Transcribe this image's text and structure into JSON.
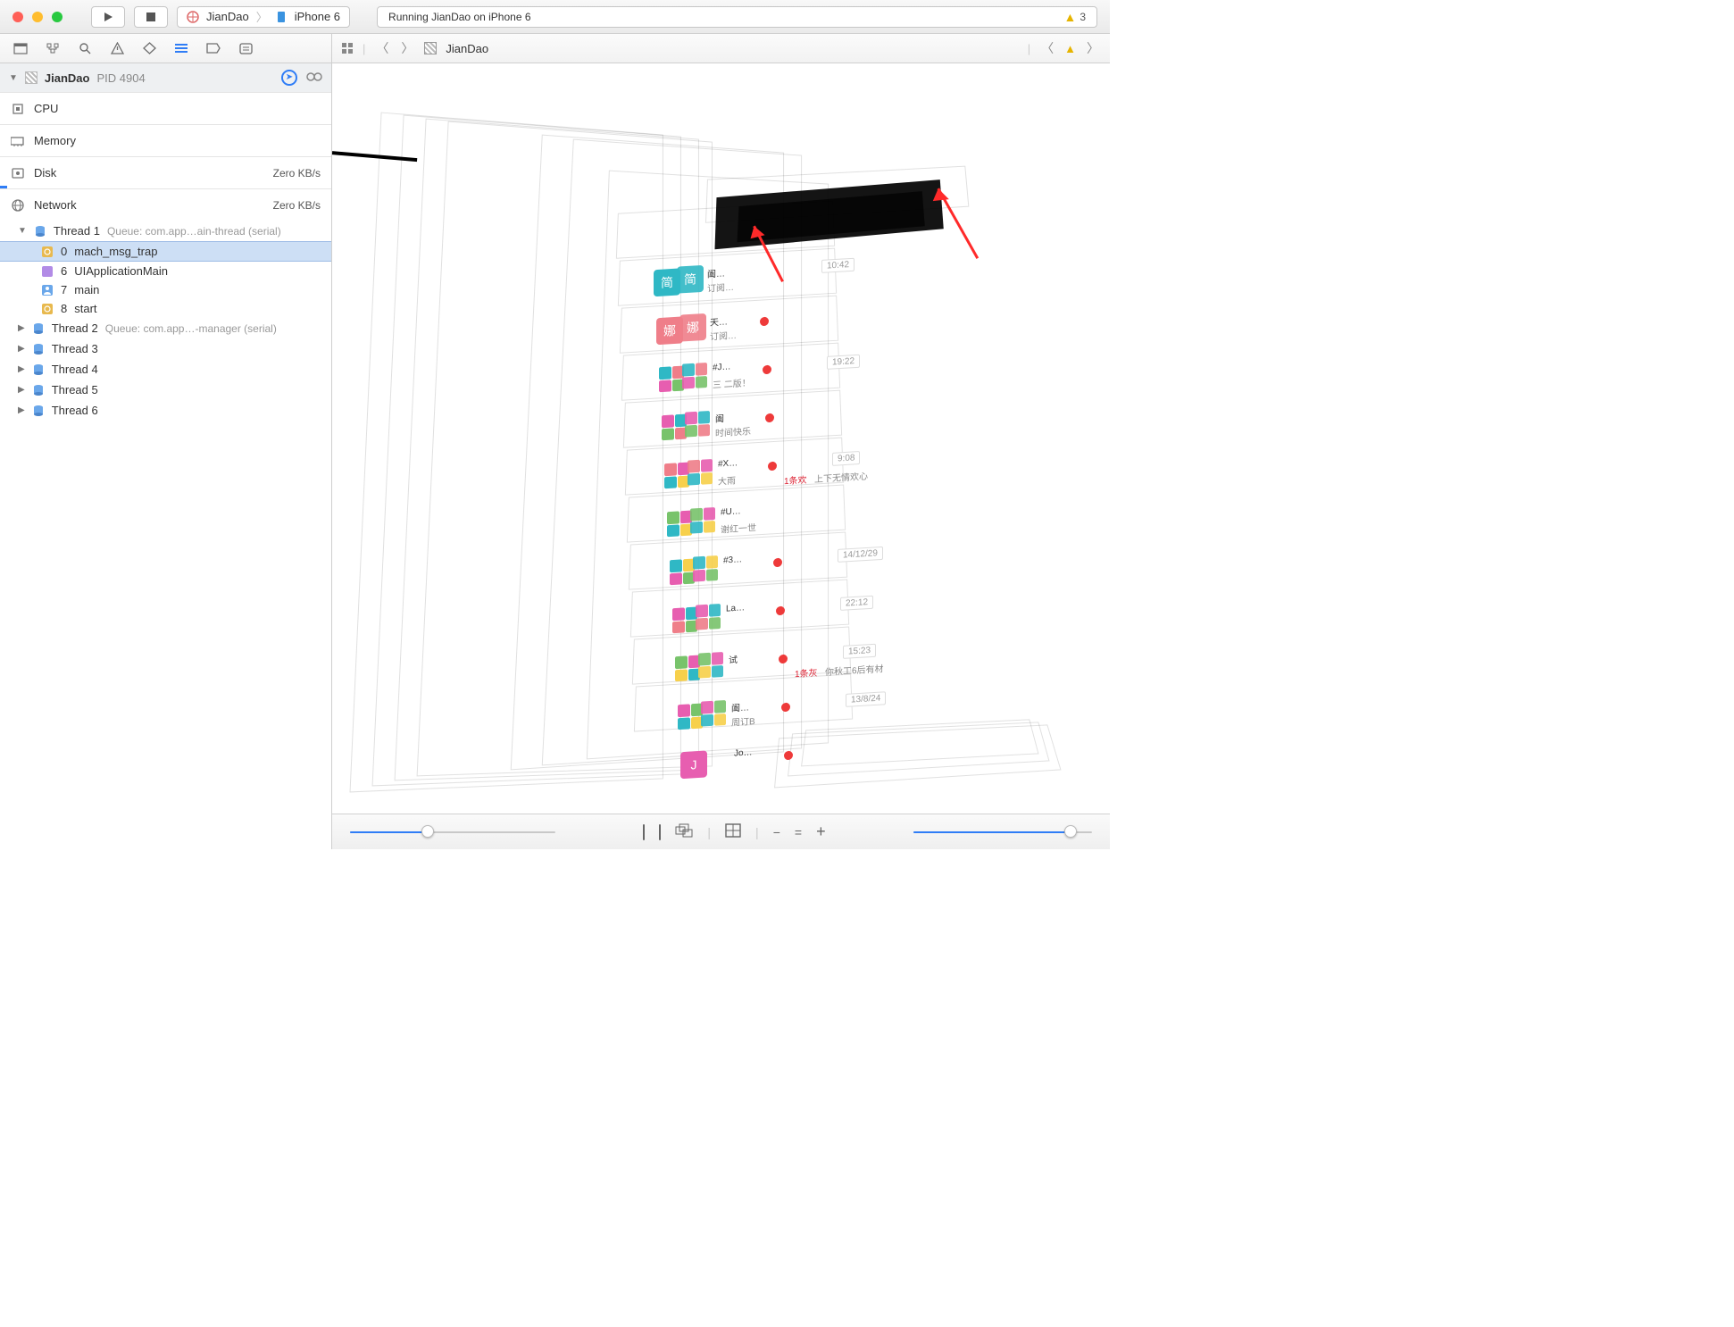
{
  "titlebar": {
    "crumb_app": "JianDao",
    "crumb_target": "iPhone 6",
    "status_text": "Running JianDao on iPhone 6",
    "warning_count": "3"
  },
  "jumpbar": {
    "project": "JianDao"
  },
  "process": {
    "name": "JianDao",
    "pid_label": "PID 4904"
  },
  "metrics": {
    "cpu": {
      "label": "CPU"
    },
    "memory": {
      "label": "Memory"
    },
    "disk": {
      "label": "Disk",
      "value": "Zero KB/s"
    },
    "network": {
      "label": "Network",
      "value": "Zero KB/s"
    }
  },
  "threads": [
    {
      "title": "Thread 1",
      "queue": "Queue: com.app…ain-thread (serial)",
      "expanded": true
    },
    {
      "title": "Thread 2",
      "queue": "Queue: com.app…-manager (serial)",
      "expanded": false
    },
    {
      "title": "Thread 3",
      "queue": "",
      "expanded": false
    },
    {
      "title": "Thread 4",
      "queue": "",
      "expanded": false
    },
    {
      "title": "Thread 5",
      "queue": "",
      "expanded": false
    },
    {
      "title": "Thread 6",
      "queue": "",
      "expanded": false
    }
  ],
  "frames": [
    {
      "idx": "0",
      "name": "mach_msg_trap",
      "selected": true,
      "icon": "gear"
    },
    {
      "idx": "6",
      "name": "UIApplicationMain",
      "selected": false,
      "icon": "app"
    },
    {
      "idx": "7",
      "name": "main",
      "selected": false,
      "icon": "user"
    },
    {
      "idx": "8",
      "name": "start",
      "selected": false,
      "icon": "gear"
    }
  ],
  "cells": [
    {
      "avatar": "简",
      "avatar2": "简",
      "av_class": "teal",
      "title": "阖…",
      "sub": "订阅…",
      "dot": false,
      "ts": "10:42"
    },
    {
      "avatar": "娜",
      "avatar2": "娜",
      "av_class": "pink",
      "title": "天…",
      "sub": "订阅…",
      "dot": true,
      "ts": ""
    },
    {
      "quad": [
        "#2fb8c5",
        "#ef7e89",
        "#e75eb0",
        "#78c36b"
      ],
      "title": "#J…",
      "sub": "三 二版！",
      "dot": true,
      "ts": "19:22"
    },
    {
      "quad": [
        "#e75eb0",
        "#2fb8c5",
        "#78c36b",
        "#ef7e89"
      ],
      "title": "阖",
      "sub": "时间快乐",
      "dot": true,
      "ts": ""
    },
    {
      "quad": [
        "#ef7e89",
        "#e75eb0",
        "#2fb8c5",
        "#f7d04b"
      ],
      "title": "#X…",
      "sub": "大雨",
      "dot": true,
      "ts": "9:08",
      "note": "上下无情欢心",
      "pinsub": "1条欢"
    },
    {
      "quad": [
        "#78c36b",
        "#e75eb0",
        "#2fb8c5",
        "#f7d04b"
      ],
      "title": "#U…",
      "sub": "谢红一世",
      "dot": false,
      "ts": ""
    },
    {
      "quad": [
        "#2fb8c5",
        "#f7d04b",
        "#e75eb0",
        "#78c36b"
      ],
      "title": "#3…",
      "sub": "",
      "dot": true,
      "ts": "14/12/29"
    },
    {
      "quad": [
        "#e75eb0",
        "#2fb8c5",
        "#ef7e89",
        "#78c36b"
      ],
      "title": "La…",
      "sub": "",
      "dot": true,
      "ts": "22:12"
    },
    {
      "quad": [
        "#78c36b",
        "#e75eb0",
        "#f7d04b",
        "#2fb8c5"
      ],
      "title": "试",
      "sub": "",
      "dot": true,
      "ts": "15:23",
      "note": "你秋工6后有材",
      "pinsub": "1条灰"
    },
    {
      "quad": [
        "#e75eb0",
        "#78c36b",
        "#2fb8c5",
        "#f7d04b"
      ],
      "title": "阖…",
      "sub": "周订B",
      "dot": true,
      "ts": "13/8/24"
    },
    {
      "avatar": "J",
      "av_class": "mag",
      "title": "Jo…",
      "sub": "",
      "dot": true,
      "ts": ""
    }
  ],
  "bottom": {
    "left_slider_pct": 38,
    "right_slider_pct": 88
  }
}
